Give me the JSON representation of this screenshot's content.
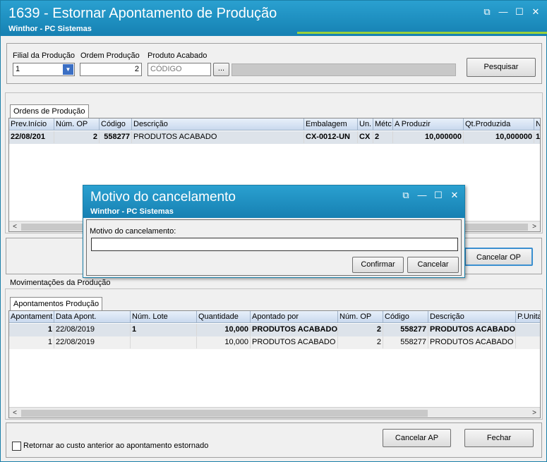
{
  "window": {
    "title": "1639 - Estornar Apontamento de Produção",
    "subtitle": "Winthor - PC Sistemas",
    "controls": {
      "restore": "⧉",
      "minimize": "—",
      "maximize": "☐",
      "close": "✕"
    }
  },
  "filters": {
    "filial_label": "Filial da Produção",
    "filial_value": "1",
    "ordem_label": "Ordem Produção",
    "ordem_value": "2",
    "produto_label": "Produto Acabado",
    "produto_placeholder": "CÓDIGO",
    "produto_lookup": "...",
    "produto_desc": "",
    "pesquisar_label": "Pesquisar"
  },
  "ordens": {
    "tab_label": "Ordens de Produção",
    "columns": [
      "Prev.Início",
      "Núm. OP",
      "Código",
      "Descrição",
      "Embalagem",
      "Un.",
      "Métc",
      "A Produzir",
      "Qt.Produzida",
      "N"
    ],
    "rows": [
      [
        "22/08/201",
        "2",
        "558277",
        "PRODUTOS ACABADO",
        "CX-0012-UN",
        "CX",
        "2",
        "10,000000",
        "10,000000",
        "1"
      ]
    ]
  },
  "cancel_op_label": "Cancelar OP",
  "movimentacoes": {
    "section_label": "Movimentações da Produção",
    "tab_label": "Apontamentos Produção",
    "columns": [
      "Apontament",
      "Data Apont.",
      "Núm. Lote",
      "Quantidade",
      "Apontado por",
      "Núm. OP",
      "Código",
      "Descrição",
      "P.Unita"
    ],
    "rows": [
      [
        "1",
        "22/08/2019",
        "1",
        "10,000",
        "PRODUTOS ACABADO",
        "2",
        "558277",
        "PRODUTOS ACABADO",
        ""
      ],
      [
        "1",
        "22/08/2019",
        "",
        "10,000",
        "PRODUTOS ACABADO",
        "2",
        "558277",
        "PRODUTOS ACABADO",
        ""
      ]
    ]
  },
  "footer": {
    "checkbox_label": "Retornar ao custo anterior ao apontamento estornado",
    "checkbox_checked": false,
    "cancelar_ap_label": "Cancelar AP",
    "fechar_label": "Fechar"
  },
  "dialog": {
    "title": "Motivo do cancelamento",
    "subtitle": "Winthor - PC Sistemas",
    "field_label": "Motivo do cancelamento:",
    "field_value": "",
    "confirmar_label": "Confirmar",
    "cancelar_label": "Cancelar"
  },
  "colors": {
    "title_bar": "#1e8fc0",
    "accent_green": "#9bd03a",
    "selected_row": "#dde3ea"
  }
}
